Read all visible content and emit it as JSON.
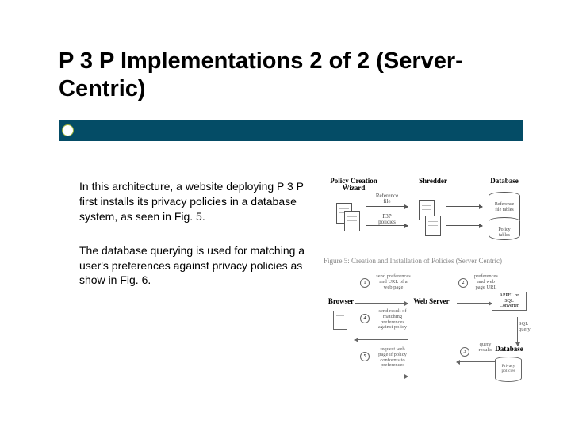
{
  "title": "P 3 P Implementations 2 of 2 (Server-Centric)",
  "body": {
    "p1": "In this architecture, a website deploying P 3 P first installs its privacy policies in a database system, as seen in Fig. 5.",
    "p2": "The database querying is used for matching a user's preferences against privacy policies as show in Fig. 6."
  },
  "fig5": {
    "heads": {
      "wizard": "Policy Creation\nWizard",
      "shredder": "Shredder",
      "database": "Database"
    },
    "arrow_top": "Reference\nfile",
    "arrow_bottom": "P3P\npolicies",
    "db_toplabel": "Reference\nfile tables",
    "db_bottomlabel": "Policy\ntables",
    "caption": "Figure 5: Creation and Installation of Policies (Server Centric)"
  },
  "fig6": {
    "browser": "Browser",
    "webserver": "Web Server",
    "appel": "APPEL or\nSQL\nConverter",
    "database": "Database",
    "db_label": "Privacy\npolicies",
    "step1": "send preferences\nand URL of a\nweb page",
    "step2": "preferences\nand web\npage URL",
    "sqlq": "SQL\nquery",
    "step3": "query\nresults",
    "step4": "send result of\nmatching\npreferences\nagainst policy",
    "step5": "request web\npage if policy\nconforms to\npreferences",
    "n1": "1",
    "n2": "2",
    "n3": "3",
    "n4": "4",
    "n5": "5"
  }
}
